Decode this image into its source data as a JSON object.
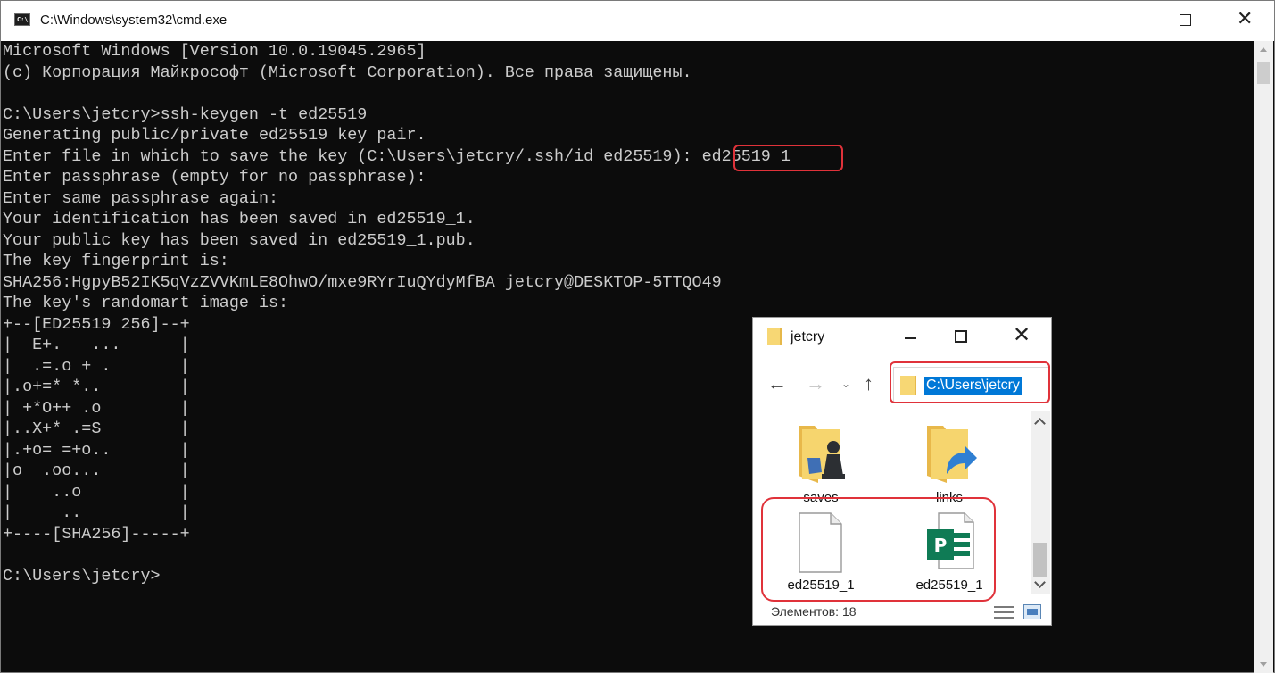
{
  "cmd": {
    "title": "C:\\Windows\\system32\\cmd.exe",
    "icon_text": "C:\\",
    "lines": [
      "Microsoft Windows [Version 10.0.19045.2965]",
      "(c) Корпорация Майкрософт (Microsoft Corporation). Все права защищены.",
      "",
      "C:\\Users\\jetcry>ssh-keygen -t ed25519",
      "Generating public/private ed25519 key pair.",
      "Enter file in which to save the key (C:\\Users\\jetcry/.ssh/id_ed25519): ed25519_1",
      "Enter passphrase (empty for no passphrase):",
      "Enter same passphrase again:",
      "Your identification has been saved in ed25519_1.",
      "Your public key has been saved in ed25519_1.pub.",
      "The key fingerprint is:",
      "SHA256:HgpyB52IK5qVzZVVKmLE8OhwO/mxe9RYrIuQYdyMfBA jetcry@DESKTOP-5TTQO49",
      "The key's randomart image is:",
      "+--[ED25519 256]--+",
      "|  E+.   ...      |",
      "|  .=.o + .       |",
      "|.o+=* *..        |",
      "| +*O++ .o        |",
      "|..X+* .=S        |",
      "|.+o= =+o..       |",
      "|o  .oo...        |",
      "|    ..o          |",
      "|     ..          |",
      "+----[SHA256]-----+",
      "",
      "C:\\Users\\jetcry>"
    ]
  },
  "explorer": {
    "title": "jetcry",
    "address": "C:\\Users\\jetcry",
    "items": [
      {
        "label": "saves"
      },
      {
        "label": "links"
      },
      {
        "label": "ed25519_1"
      },
      {
        "label": "ed25519_1"
      }
    ],
    "status": "Элементов: 18"
  },
  "colors": {
    "console_bg": "#0c0c0c",
    "console_text": "#cccccc",
    "highlight": "#e0323a",
    "selection": "#0078d7"
  }
}
